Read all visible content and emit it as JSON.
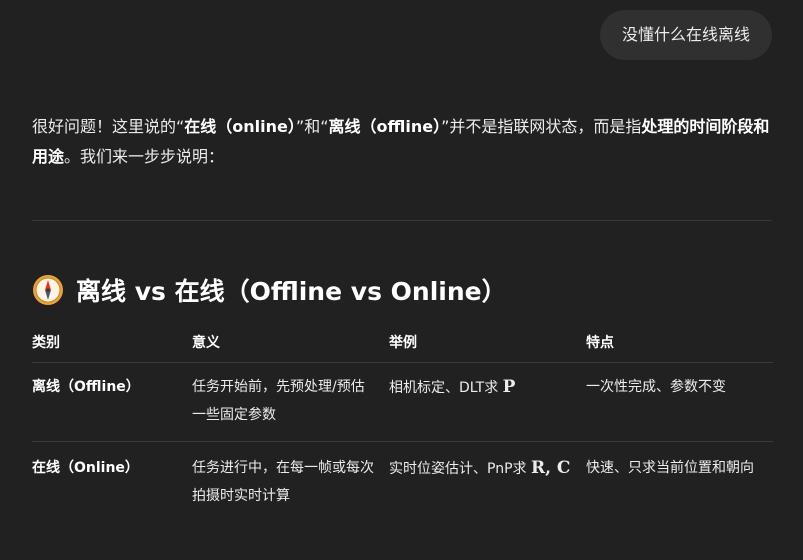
{
  "user_message": "没懂什么在线离线",
  "answer": {
    "p1": "很好问题！这里说的“",
    "b1": "在线（online）",
    "p2": "”和“",
    "b2": "离线（offline）",
    "p3": "”并不是指联网状态，而是指",
    "b3": "处理的时间阶段和用途",
    "p4": "。我们来一步步说明："
  },
  "section": {
    "icon": "compass-icon",
    "title": "离线 vs 在线（Offline vs Online）"
  },
  "table": {
    "headers": [
      "类别",
      "意义",
      "举例",
      "特点"
    ],
    "rows": [
      {
        "category": "离线（Offline）",
        "meaning": "任务开始前，先预处理/预估一些固定参数",
        "example_text": "相机标定、DLT求 ",
        "example_math": "P",
        "feature": "一次性完成、参数不变"
      },
      {
        "category": "在线（Online）",
        "meaning": "任务进行中，在每一帧或每次拍摄时实时计算",
        "example_text": "实时位姿估计、PnP求 ",
        "example_math": "R, C",
        "feature": "快速、只求当前位置和朝向"
      }
    ]
  },
  "colors": {
    "background": "#212121",
    "bubble": "#303030",
    "text": "#ececec",
    "divider": "#383838"
  }
}
